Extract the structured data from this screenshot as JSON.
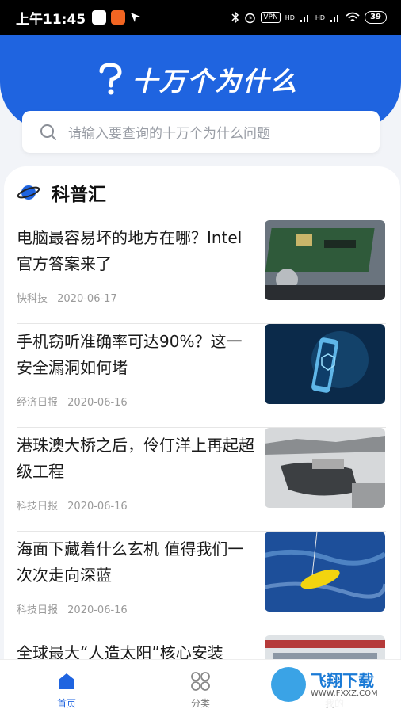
{
  "status_bar": {
    "time": "上午11:45",
    "vpn": "VPN",
    "hd1": "HD",
    "hd2": "HD",
    "battery": "39"
  },
  "header": {
    "title": "十万个为什么"
  },
  "search": {
    "placeholder": "请输入要查询的十万个为什么问题"
  },
  "section": {
    "title": "科普汇"
  },
  "articles": [
    {
      "title": "电脑最容易坏的地方在哪？Intel官方答案来了",
      "source": "快科技",
      "date": "2020-06-17"
    },
    {
      "title": "手机窃听准确率可达90%？这一安全漏洞如何堵",
      "source": "经济日报",
      "date": "2020-06-16"
    },
    {
      "title": "港珠澳大桥之后，伶仃洋上再起超级工程",
      "source": "科技日报",
      "date": "2020-06-16"
    },
    {
      "title": "海面下藏着什么玄机 值得我们一次次走向深蓝",
      "source": "科技日报",
      "date": "2020-06-16"
    },
    {
      "title": "全球最大“人造太阳”核心安装",
      "source": "",
      "date": ""
    }
  ],
  "tabbar": {
    "home": "首页",
    "category": "分类",
    "mine": "我的"
  },
  "watermark": {
    "text": "飞翔下载",
    "url": "WWW.FXXZ.COM"
  },
  "colors": {
    "primary": "#1f64e0"
  }
}
